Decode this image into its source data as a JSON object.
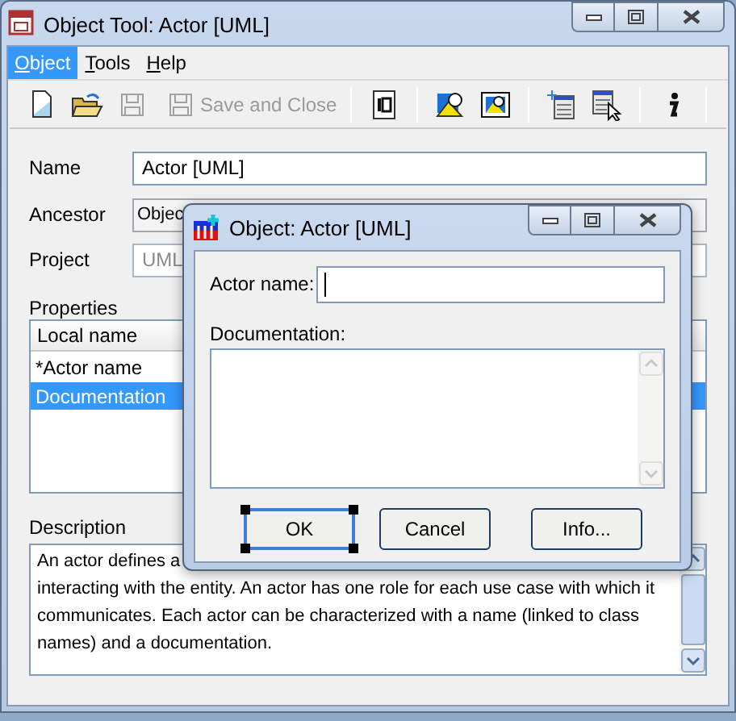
{
  "window": {
    "title": "Object Tool: Actor [UML]"
  },
  "menu": [
    {
      "label": "Object",
      "selected": true
    },
    {
      "label": "Tools",
      "selected": false
    },
    {
      "label": "Help",
      "selected": false
    }
  ],
  "toolbar": {
    "save_disabled": true,
    "save_and_close": {
      "label": "Save and Close",
      "disabled": true
    }
  },
  "form": {
    "name_label": "Name",
    "name_value": "Actor [UML]",
    "ancestor_label": "Ancestor",
    "ancestor_value": "Objec",
    "project_label": "Project",
    "project_value": "UML",
    "project_disabled": true
  },
  "properties": {
    "label": "Properties",
    "column_1": "Local name",
    "rows": [
      {
        "text": "*Actor name",
        "selected": false
      },
      {
        "text": "Documentation",
        "selected": true
      }
    ]
  },
  "description": {
    "label": "Description",
    "lines": [
      "An actor defines a",
      "interacting with the entity. An actor has one role for each use case with which it",
      "communicates. Each actor can be characterized with a name (linked to class",
      "names) and a documentation."
    ]
  },
  "dialog": {
    "title": "Object: Actor [UML]",
    "actor_name_label": "Actor name:",
    "documentation_label": "Documentation:",
    "buttons": [
      {
        "label": "OK",
        "focused": true
      },
      {
        "label": "Cancel",
        "focused": false
      },
      {
        "label": "Info...",
        "focused": false
      }
    ]
  }
}
